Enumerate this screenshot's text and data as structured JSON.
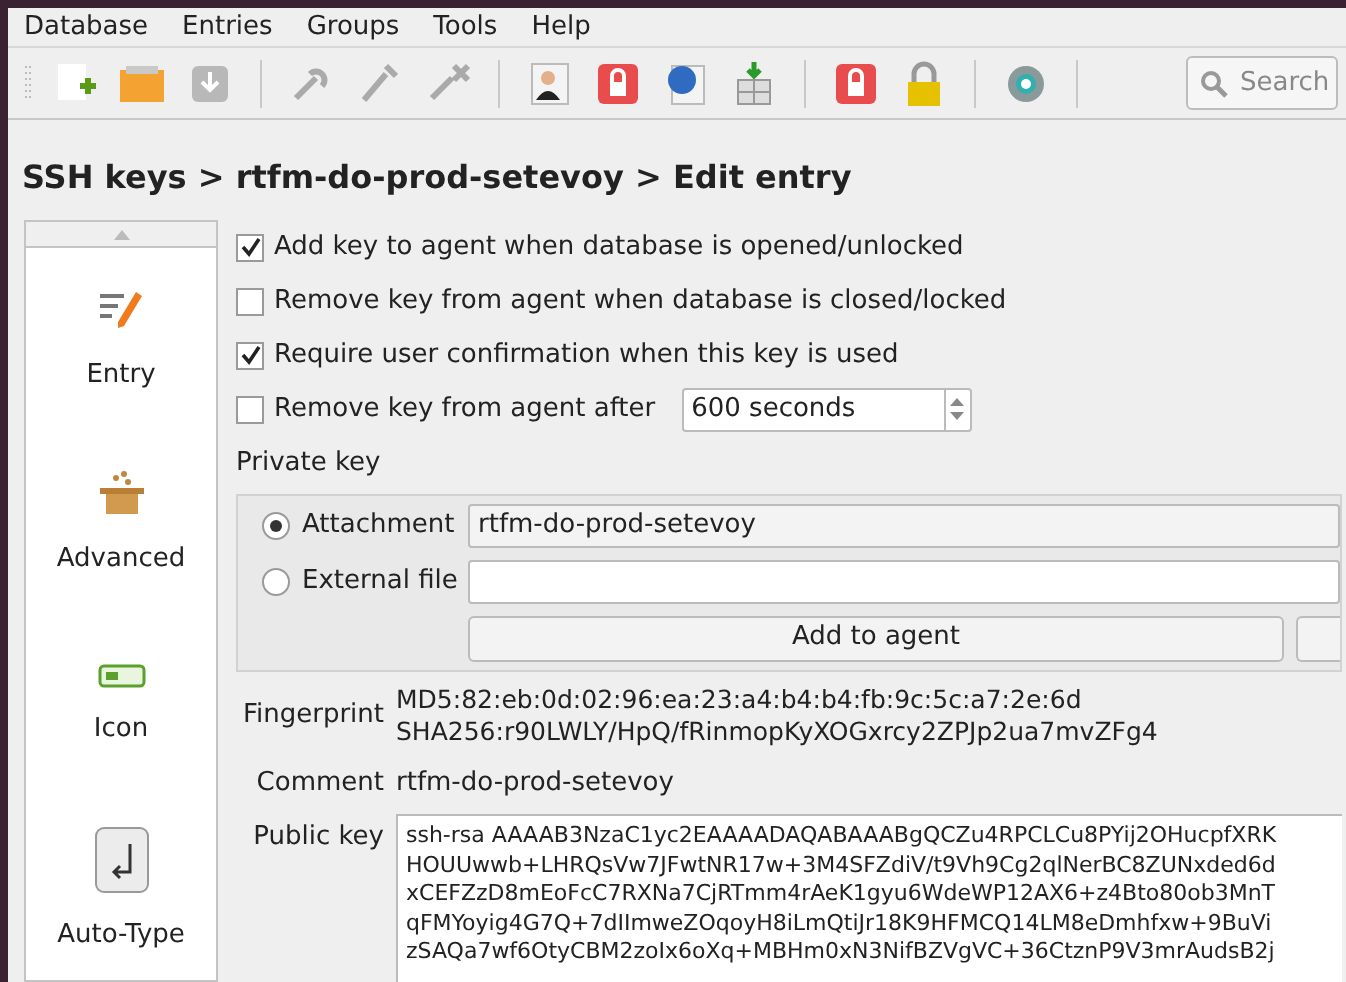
{
  "menu": [
    "Database",
    "Entries",
    "Groups",
    "Tools",
    "Help"
  ],
  "search": {
    "placeholder": "Search"
  },
  "breadcrumb": "SSH keys > rtfm-do-prod-setevoy > Edit entry",
  "sidebar": {
    "items": [
      {
        "label": "Entry",
        "kind": "entry"
      },
      {
        "label": "Advanced",
        "kind": "advanced"
      },
      {
        "label": "Icon",
        "kind": "icon"
      },
      {
        "label": "Auto-Type",
        "kind": "autotype"
      }
    ]
  },
  "options": [
    {
      "label": "Add key to agent when database is opened/unlocked",
      "checked": true
    },
    {
      "label": "Remove key from agent when database is closed/locked",
      "checked": false
    },
    {
      "label": "Require user confirmation when this key is used",
      "checked": true
    },
    {
      "label": "Remove key from agent after",
      "checked": false,
      "spin_value": "600 seconds"
    }
  ],
  "private_key": {
    "title": "Private key",
    "sources": [
      {
        "label": "Attachment",
        "selected": true,
        "kind": "combo",
        "value": "rtfm-do-prod-setevoy"
      },
      {
        "label": "External file",
        "selected": false,
        "kind": "file"
      }
    ],
    "button": "Add to agent"
  },
  "fingerprint": {
    "label": "Fingerprint",
    "lines": [
      "MD5:82:eb:0d:02:96:ea:23:a4:b4:b4:fb:9c:5c:a7:2e:6d",
      "SHA256:r90LWLY/HpQ/fRinmopKyXOGxrcy2ZPJp2ua7mvZFg4"
    ]
  },
  "comment": {
    "label": "Comment",
    "value": "rtfm-do-prod-setevoy"
  },
  "public_key": {
    "label": "Public key",
    "lines": [
      "ssh-rsa AAAAB3NzaC1yc2EAAAADAQABAAABgQCZu4RPCLCu8PYij2OHucpfXRK",
      "HOUUwwb+LHRQsVw7JFwtNR17w+3M4SFZdiV/t9Vh9Cg2qlNerBC8ZUNxded6d",
      "xCEFZzD8mEoFcC7RXNa7CjRTmm4rAeK1gyu6WdeWP12AX6+z4Bto80ob3MnT",
      "qFMYoyig4G7Q+7dIImweZOqoyH8iLmQtiJr18K9HFMCQ14LM8eDmhfxw+9BuVi",
      "zSAQa7wf6OtyCBM2zoIx6oXq+MBHm0xN3NifBZVgVC+36CtznP9V3mrAudsB2j"
    ]
  }
}
